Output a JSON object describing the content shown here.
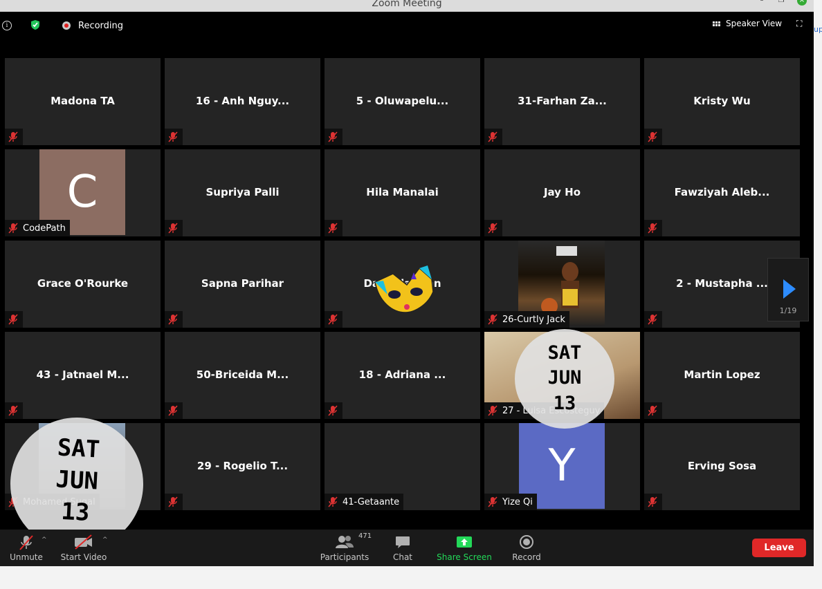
{
  "window": {
    "title": "Zoom Meeting"
  },
  "topbar": {
    "recording_label": "Recording",
    "speaker_view_label": "Speaker View"
  },
  "tiles": [
    {
      "name": "Madona TA",
      "label": ""
    },
    {
      "name": "16 - Anh Nguy...",
      "label": ""
    },
    {
      "name": "5 - Oluwapelu...",
      "label": ""
    },
    {
      "name": "31-Farhan Za...",
      "label": ""
    },
    {
      "name": "Kristy Wu",
      "label": ""
    },
    {
      "name": "",
      "label": "CodePath",
      "avatar_letter": "C",
      "avatar_color": "#8c6d62"
    },
    {
      "name": "Supriya Palli",
      "label": ""
    },
    {
      "name": "Hila Manalai",
      "label": ""
    },
    {
      "name": "Jay Ho",
      "label": ""
    },
    {
      "name": "Fawziyah Aleb...",
      "label": ""
    },
    {
      "name": "Grace O'Rourke",
      "label": ""
    },
    {
      "name": "Sapna Parihar",
      "label": ""
    },
    {
      "name": "Daniella  ...an",
      "label": ""
    },
    {
      "name": "",
      "label": "26-Curtly Jack"
    },
    {
      "name": "2 - Mustapha ...",
      "label": ""
    },
    {
      "name": "43 - Jatnael M...",
      "label": ""
    },
    {
      "name": "50-Briceida M...",
      "label": ""
    },
    {
      "name": "18 - Adriana ...",
      "label": ""
    },
    {
      "name": "",
      "label": "27 - Luisa Escosteguy"
    },
    {
      "name": "Martin Lopez",
      "label": ""
    },
    {
      "name": "",
      "label": "Mohamed Suqal"
    },
    {
      "name": "29 - Rogelio T...",
      "label": ""
    },
    {
      "name": "",
      "label": "41-Getaante"
    },
    {
      "name": "",
      "label": "Yize Qi",
      "avatar_letter": "Y",
      "avatar_color": "#5b6ac4"
    },
    {
      "name": "Erving Sosa",
      "label": ""
    }
  ],
  "pagination": {
    "page_label": "1/19"
  },
  "sticker": {
    "day": "SAT",
    "month": "JUN",
    "date": "13"
  },
  "toolbar": {
    "unmute_label": "Unmute",
    "start_video_label": "Start Video",
    "participants_label": "Participants",
    "participants_count": "471",
    "chat_label": "Chat",
    "share_screen_label": "Share Screen",
    "record_label": "Record",
    "leave_label": "Leave"
  },
  "colors": {
    "accent_blue": "#2d8cff",
    "share_green": "#23d959",
    "leave_red": "#e02828"
  }
}
